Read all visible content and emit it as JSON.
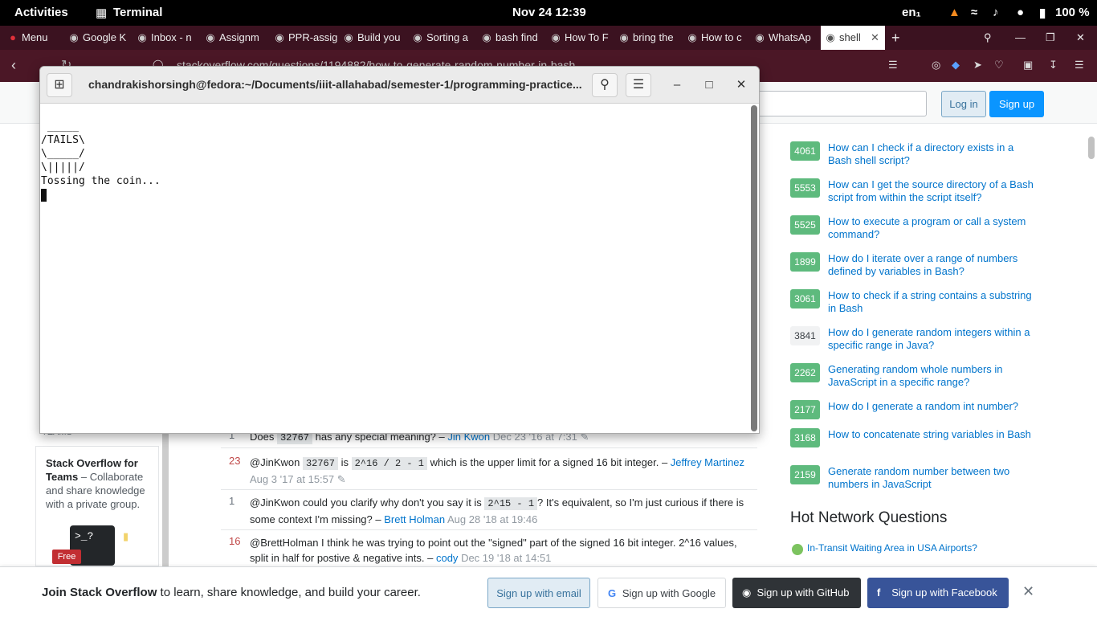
{
  "topbar": {
    "activities": "Activities",
    "app_name": "Terminal",
    "clock": "Nov 24  12:39",
    "lang": "en₁",
    "battery": "100 %"
  },
  "tabs": {
    "menu_label": "Menu",
    "items": [
      {
        "label": "Google K"
      },
      {
        "label": "Inbox - n"
      },
      {
        "label": "Assignm"
      },
      {
        "label": "PPR-assig"
      },
      {
        "label": "Build you"
      },
      {
        "label": "Sorting a"
      },
      {
        "label": "bash find"
      },
      {
        "label": "How To F"
      },
      {
        "label": "bring the"
      },
      {
        "label": "How to c"
      },
      {
        "label": "WhatsAp"
      },
      {
        "label": "shell"
      }
    ]
  },
  "address": {
    "url": "stackoverflow.com/questions/1194882/how-to-generate-random-number-in-bash"
  },
  "so_header": {
    "login": "Log in",
    "signup": "Sign up"
  },
  "terminal": {
    "title": "chandrakishorsingh@fedora:~/Documents/iiit-allahabad/semester-1/programming-practice...",
    "lines": [
      " _____",
      "/TAILS\\",
      "\\_____/",
      "\\|||||/",
      "",
      "Tossing the coin..."
    ]
  },
  "related": [
    {
      "score": "4061",
      "title": "How can I check if a directory exists in a Bash shell script?",
      "accepted": true
    },
    {
      "score": "5553",
      "title": "How can I get the source directory of a Bash script from within the script itself?",
      "accepted": true
    },
    {
      "score": "5525",
      "title": "How to execute a program or call a system command?",
      "accepted": true
    },
    {
      "score": "1899",
      "title": "How do I iterate over a range of numbers defined by variables in Bash?",
      "accepted": true
    },
    {
      "score": "3061",
      "title": "How to check if a string contains a substring in Bash",
      "accepted": true
    },
    {
      "score": "3841",
      "title": "How do I generate random integers within a specific range in Java?",
      "accepted": false
    },
    {
      "score": "2262",
      "title": "Generating random whole numbers in JavaScript in a specific range?",
      "accepted": true
    },
    {
      "score": "2177",
      "title": "How do I generate a random int number?",
      "accepted": true
    },
    {
      "score": "3168",
      "title": "How to concatenate string variables in Bash",
      "accepted": true
    },
    {
      "score": "2159",
      "title": "Generate random number between two numbers in JavaScript",
      "accepted": true
    }
  ],
  "hot_network": {
    "heading": "Hot Network Questions",
    "first": "In-Transit Waiting Area in USA Airports?"
  },
  "comments": [
    {
      "score": "1",
      "pre": "Does ",
      "code": "32767",
      "text": " has any special meaning? – ",
      "user": "Jin Kwon",
      "date": "Dec 23 '16 at 7:31"
    },
    {
      "score": "23",
      "pre": "@JinKwon ",
      "code": "32767",
      "text": " is ",
      "code2": "2^16 / 2 - 1",
      "text2": " which is the upper limit for a signed 16 bit integer. – ",
      "user": "Jeffrey Martinez",
      "date": "Aug 3 '17 at 15:57"
    },
    {
      "score": "1",
      "pre": "@JinKwon could you clarify why don't you say it is ",
      "code": "2^15 - 1",
      "text": "? It's equivalent, so I'm just curious if there is some context I'm missing? – ",
      "user": "Brett Holman",
      "date": "Aug 28 '18 at 19:46"
    },
    {
      "score": "16",
      "pre": "@BrettHolman I think he was trying to point out the \"signed\" part of the signed 16 bit integer. 2^16 values, split in half for postive & negative ints. – ",
      "user": "cody",
      "date": "Dec 19 '18 at 14:51"
    }
  ],
  "teams": {
    "title": "Stack Overflow for Teams",
    "text": " – Collaborate and share knowledge with a private group.",
    "free": "Free",
    "section": "TEAMS"
  },
  "banner": {
    "bold": "Join Stack Overflow",
    "rest": " to learn, share knowledge, and build your career.",
    "email": "Sign up with email",
    "google": "Sign up with Google",
    "github": "Sign up with GitHub",
    "facebook": "Sign up with Facebook"
  }
}
